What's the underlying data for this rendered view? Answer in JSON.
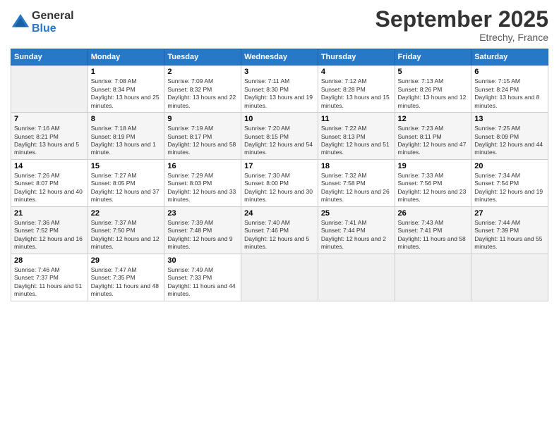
{
  "header": {
    "logo_general": "General",
    "logo_blue": "Blue",
    "title": "September 2025",
    "location": "Etrechy, France"
  },
  "weekdays": [
    "Sunday",
    "Monday",
    "Tuesday",
    "Wednesday",
    "Thursday",
    "Friday",
    "Saturday"
  ],
  "weeks": [
    [
      {
        "day": "",
        "empty": true
      },
      {
        "day": "1",
        "sunrise": "Sunrise: 7:08 AM",
        "sunset": "Sunset: 8:34 PM",
        "daylight": "Daylight: 13 hours and 25 minutes."
      },
      {
        "day": "2",
        "sunrise": "Sunrise: 7:09 AM",
        "sunset": "Sunset: 8:32 PM",
        "daylight": "Daylight: 13 hours and 22 minutes."
      },
      {
        "day": "3",
        "sunrise": "Sunrise: 7:11 AM",
        "sunset": "Sunset: 8:30 PM",
        "daylight": "Daylight: 13 hours and 19 minutes."
      },
      {
        "day": "4",
        "sunrise": "Sunrise: 7:12 AM",
        "sunset": "Sunset: 8:28 PM",
        "daylight": "Daylight: 13 hours and 15 minutes."
      },
      {
        "day": "5",
        "sunrise": "Sunrise: 7:13 AM",
        "sunset": "Sunset: 8:26 PM",
        "daylight": "Daylight: 13 hours and 12 minutes."
      },
      {
        "day": "6",
        "sunrise": "Sunrise: 7:15 AM",
        "sunset": "Sunset: 8:24 PM",
        "daylight": "Daylight: 13 hours and 8 minutes."
      }
    ],
    [
      {
        "day": "7",
        "sunrise": "Sunrise: 7:16 AM",
        "sunset": "Sunset: 8:21 PM",
        "daylight": "Daylight: 13 hours and 5 minutes."
      },
      {
        "day": "8",
        "sunrise": "Sunrise: 7:18 AM",
        "sunset": "Sunset: 8:19 PM",
        "daylight": "Daylight: 13 hours and 1 minute."
      },
      {
        "day": "9",
        "sunrise": "Sunrise: 7:19 AM",
        "sunset": "Sunset: 8:17 PM",
        "daylight": "Daylight: 12 hours and 58 minutes."
      },
      {
        "day": "10",
        "sunrise": "Sunrise: 7:20 AM",
        "sunset": "Sunset: 8:15 PM",
        "daylight": "Daylight: 12 hours and 54 minutes."
      },
      {
        "day": "11",
        "sunrise": "Sunrise: 7:22 AM",
        "sunset": "Sunset: 8:13 PM",
        "daylight": "Daylight: 12 hours and 51 minutes."
      },
      {
        "day": "12",
        "sunrise": "Sunrise: 7:23 AM",
        "sunset": "Sunset: 8:11 PM",
        "daylight": "Daylight: 12 hours and 47 minutes."
      },
      {
        "day": "13",
        "sunrise": "Sunrise: 7:25 AM",
        "sunset": "Sunset: 8:09 PM",
        "daylight": "Daylight: 12 hours and 44 minutes."
      }
    ],
    [
      {
        "day": "14",
        "sunrise": "Sunrise: 7:26 AM",
        "sunset": "Sunset: 8:07 PM",
        "daylight": "Daylight: 12 hours and 40 minutes."
      },
      {
        "day": "15",
        "sunrise": "Sunrise: 7:27 AM",
        "sunset": "Sunset: 8:05 PM",
        "daylight": "Daylight: 12 hours and 37 minutes."
      },
      {
        "day": "16",
        "sunrise": "Sunrise: 7:29 AM",
        "sunset": "Sunset: 8:03 PM",
        "daylight": "Daylight: 12 hours and 33 minutes."
      },
      {
        "day": "17",
        "sunrise": "Sunrise: 7:30 AM",
        "sunset": "Sunset: 8:00 PM",
        "daylight": "Daylight: 12 hours and 30 minutes."
      },
      {
        "day": "18",
        "sunrise": "Sunrise: 7:32 AM",
        "sunset": "Sunset: 7:58 PM",
        "daylight": "Daylight: 12 hours and 26 minutes."
      },
      {
        "day": "19",
        "sunrise": "Sunrise: 7:33 AM",
        "sunset": "Sunset: 7:56 PM",
        "daylight": "Daylight: 12 hours and 23 minutes."
      },
      {
        "day": "20",
        "sunrise": "Sunrise: 7:34 AM",
        "sunset": "Sunset: 7:54 PM",
        "daylight": "Daylight: 12 hours and 19 minutes."
      }
    ],
    [
      {
        "day": "21",
        "sunrise": "Sunrise: 7:36 AM",
        "sunset": "Sunset: 7:52 PM",
        "daylight": "Daylight: 12 hours and 16 minutes."
      },
      {
        "day": "22",
        "sunrise": "Sunrise: 7:37 AM",
        "sunset": "Sunset: 7:50 PM",
        "daylight": "Daylight: 12 hours and 12 minutes."
      },
      {
        "day": "23",
        "sunrise": "Sunrise: 7:39 AM",
        "sunset": "Sunset: 7:48 PM",
        "daylight": "Daylight: 12 hours and 9 minutes."
      },
      {
        "day": "24",
        "sunrise": "Sunrise: 7:40 AM",
        "sunset": "Sunset: 7:46 PM",
        "daylight": "Daylight: 12 hours and 5 minutes."
      },
      {
        "day": "25",
        "sunrise": "Sunrise: 7:41 AM",
        "sunset": "Sunset: 7:44 PM",
        "daylight": "Daylight: 12 hours and 2 minutes."
      },
      {
        "day": "26",
        "sunrise": "Sunrise: 7:43 AM",
        "sunset": "Sunset: 7:41 PM",
        "daylight": "Daylight: 11 hours and 58 minutes."
      },
      {
        "day": "27",
        "sunrise": "Sunrise: 7:44 AM",
        "sunset": "Sunset: 7:39 PM",
        "daylight": "Daylight: 11 hours and 55 minutes."
      }
    ],
    [
      {
        "day": "28",
        "sunrise": "Sunrise: 7:46 AM",
        "sunset": "Sunset: 7:37 PM",
        "daylight": "Daylight: 11 hours and 51 minutes."
      },
      {
        "day": "29",
        "sunrise": "Sunrise: 7:47 AM",
        "sunset": "Sunset: 7:35 PM",
        "daylight": "Daylight: 11 hours and 48 minutes."
      },
      {
        "day": "30",
        "sunrise": "Sunrise: 7:49 AM",
        "sunset": "Sunset: 7:33 PM",
        "daylight": "Daylight: 11 hours and 44 minutes."
      },
      {
        "day": "",
        "empty": true
      },
      {
        "day": "",
        "empty": true
      },
      {
        "day": "",
        "empty": true
      },
      {
        "day": "",
        "empty": true
      }
    ]
  ]
}
